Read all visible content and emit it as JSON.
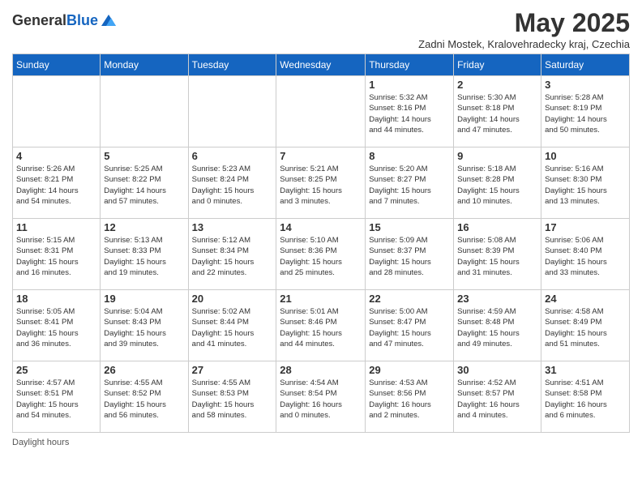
{
  "header": {
    "logo_general": "General",
    "logo_blue": "Blue",
    "month_title": "May 2025",
    "subtitle": "Zadni Mostek, Kralovehradecky kraj, Czechia"
  },
  "columns": [
    "Sunday",
    "Monday",
    "Tuesday",
    "Wednesday",
    "Thursday",
    "Friday",
    "Saturday"
  ],
  "weeks": [
    [
      {
        "day": "",
        "info": ""
      },
      {
        "day": "",
        "info": ""
      },
      {
        "day": "",
        "info": ""
      },
      {
        "day": "",
        "info": ""
      },
      {
        "day": "1",
        "info": "Sunrise: 5:32 AM\nSunset: 8:16 PM\nDaylight: 14 hours\nand 44 minutes."
      },
      {
        "day": "2",
        "info": "Sunrise: 5:30 AM\nSunset: 8:18 PM\nDaylight: 14 hours\nand 47 minutes."
      },
      {
        "day": "3",
        "info": "Sunrise: 5:28 AM\nSunset: 8:19 PM\nDaylight: 14 hours\nand 50 minutes."
      }
    ],
    [
      {
        "day": "4",
        "info": "Sunrise: 5:26 AM\nSunset: 8:21 PM\nDaylight: 14 hours\nand 54 minutes."
      },
      {
        "day": "5",
        "info": "Sunrise: 5:25 AM\nSunset: 8:22 PM\nDaylight: 14 hours\nand 57 minutes."
      },
      {
        "day": "6",
        "info": "Sunrise: 5:23 AM\nSunset: 8:24 PM\nDaylight: 15 hours\nand 0 minutes."
      },
      {
        "day": "7",
        "info": "Sunrise: 5:21 AM\nSunset: 8:25 PM\nDaylight: 15 hours\nand 3 minutes."
      },
      {
        "day": "8",
        "info": "Sunrise: 5:20 AM\nSunset: 8:27 PM\nDaylight: 15 hours\nand 7 minutes."
      },
      {
        "day": "9",
        "info": "Sunrise: 5:18 AM\nSunset: 8:28 PM\nDaylight: 15 hours\nand 10 minutes."
      },
      {
        "day": "10",
        "info": "Sunrise: 5:16 AM\nSunset: 8:30 PM\nDaylight: 15 hours\nand 13 minutes."
      }
    ],
    [
      {
        "day": "11",
        "info": "Sunrise: 5:15 AM\nSunset: 8:31 PM\nDaylight: 15 hours\nand 16 minutes."
      },
      {
        "day": "12",
        "info": "Sunrise: 5:13 AM\nSunset: 8:33 PM\nDaylight: 15 hours\nand 19 minutes."
      },
      {
        "day": "13",
        "info": "Sunrise: 5:12 AM\nSunset: 8:34 PM\nDaylight: 15 hours\nand 22 minutes."
      },
      {
        "day": "14",
        "info": "Sunrise: 5:10 AM\nSunset: 8:36 PM\nDaylight: 15 hours\nand 25 minutes."
      },
      {
        "day": "15",
        "info": "Sunrise: 5:09 AM\nSunset: 8:37 PM\nDaylight: 15 hours\nand 28 minutes."
      },
      {
        "day": "16",
        "info": "Sunrise: 5:08 AM\nSunset: 8:39 PM\nDaylight: 15 hours\nand 31 minutes."
      },
      {
        "day": "17",
        "info": "Sunrise: 5:06 AM\nSunset: 8:40 PM\nDaylight: 15 hours\nand 33 minutes."
      }
    ],
    [
      {
        "day": "18",
        "info": "Sunrise: 5:05 AM\nSunset: 8:41 PM\nDaylight: 15 hours\nand 36 minutes."
      },
      {
        "day": "19",
        "info": "Sunrise: 5:04 AM\nSunset: 8:43 PM\nDaylight: 15 hours\nand 39 minutes."
      },
      {
        "day": "20",
        "info": "Sunrise: 5:02 AM\nSunset: 8:44 PM\nDaylight: 15 hours\nand 41 minutes."
      },
      {
        "day": "21",
        "info": "Sunrise: 5:01 AM\nSunset: 8:46 PM\nDaylight: 15 hours\nand 44 minutes."
      },
      {
        "day": "22",
        "info": "Sunrise: 5:00 AM\nSunset: 8:47 PM\nDaylight: 15 hours\nand 47 minutes."
      },
      {
        "day": "23",
        "info": "Sunrise: 4:59 AM\nSunset: 8:48 PM\nDaylight: 15 hours\nand 49 minutes."
      },
      {
        "day": "24",
        "info": "Sunrise: 4:58 AM\nSunset: 8:49 PM\nDaylight: 15 hours\nand 51 minutes."
      }
    ],
    [
      {
        "day": "25",
        "info": "Sunrise: 4:57 AM\nSunset: 8:51 PM\nDaylight: 15 hours\nand 54 minutes."
      },
      {
        "day": "26",
        "info": "Sunrise: 4:55 AM\nSunset: 8:52 PM\nDaylight: 15 hours\nand 56 minutes."
      },
      {
        "day": "27",
        "info": "Sunrise: 4:55 AM\nSunset: 8:53 PM\nDaylight: 15 hours\nand 58 minutes."
      },
      {
        "day": "28",
        "info": "Sunrise: 4:54 AM\nSunset: 8:54 PM\nDaylight: 16 hours\nand 0 minutes."
      },
      {
        "day": "29",
        "info": "Sunrise: 4:53 AM\nSunset: 8:56 PM\nDaylight: 16 hours\nand 2 minutes."
      },
      {
        "day": "30",
        "info": "Sunrise: 4:52 AM\nSunset: 8:57 PM\nDaylight: 16 hours\nand 4 minutes."
      },
      {
        "day": "31",
        "info": "Sunrise: 4:51 AM\nSunset: 8:58 PM\nDaylight: 16 hours\nand 6 minutes."
      }
    ]
  ],
  "footer": {
    "daylight_label": "Daylight hours"
  }
}
